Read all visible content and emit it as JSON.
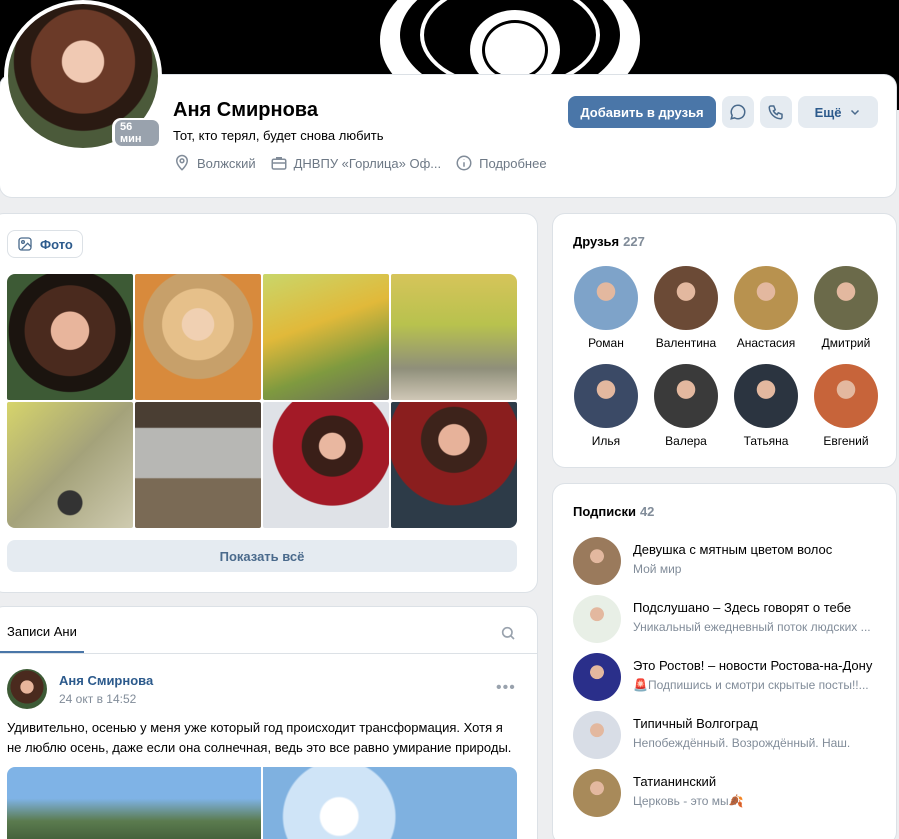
{
  "profile": {
    "name": "Аня Смирнова",
    "status": "Тот, кто терял, будет снова любить",
    "online": "56 мин",
    "city": "Волжский",
    "work": "ДНВПУ «Горлица» Оф...",
    "more_info": "Подробнее",
    "add_friend": "Добавить в друзья",
    "more": "Ещё"
  },
  "photos": {
    "tab": "Фото",
    "show_all": "Показать всё"
  },
  "wall": {
    "tab": "Записи Ани",
    "post": {
      "author": "Аня Смирнова",
      "date": "24 окт в 14:52",
      "text": "Удивительно, осенью у меня уже который год происходит трансформация. Хотя я не люблю осень, даже если она солнечная, ведь это все равно умирание природы."
    }
  },
  "friends": {
    "title": "Друзья",
    "count": "227",
    "items": [
      {
        "name": "Роман",
        "color": "#7ea3c9"
      },
      {
        "name": "Валентина",
        "color": "#6b4a36"
      },
      {
        "name": "Анастасия",
        "color": "#b8924f"
      },
      {
        "name": "Дмитрий",
        "color": "#6b6a4a"
      },
      {
        "name": "Илья",
        "color": "#3b4a66"
      },
      {
        "name": "Валера",
        "color": "#3a3a3a"
      },
      {
        "name": "Татьяна",
        "color": "#2b3440"
      },
      {
        "name": "Евгений",
        "color": "#c7643a"
      }
    ]
  },
  "subscriptions": {
    "title": "Подписки",
    "count": "42",
    "items": [
      {
        "name": "Девушка с мятным цветом волос",
        "desc": "Мой мир",
        "color": "#9a7a5c"
      },
      {
        "name": "Подслушано – Здесь говорят о тебе",
        "desc": "Уникальный ежедневный поток людских ...",
        "color": "#e8efe6"
      },
      {
        "name": "Это Ростов! – новости Ростова-на-Дону",
        "desc": "🚨Подпишись и смотри скрытые посты!!...",
        "color": "#2a2f8a"
      },
      {
        "name": "Типичный Волгоград",
        "desc": "Непобеждённый. Возрождённый. Наш.",
        "color": "#d8dde6"
      },
      {
        "name": "Татианинский",
        "desc": "Церковь - это мы🍂",
        "color": "#a88a5a"
      }
    ]
  }
}
